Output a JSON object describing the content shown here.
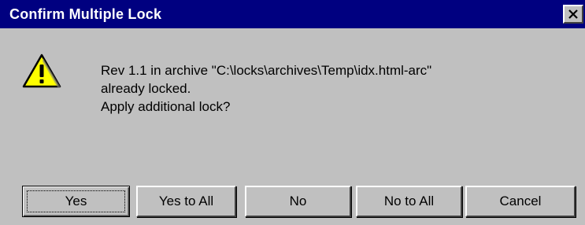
{
  "window": {
    "title": "Confirm Multiple Lock",
    "close_glyph": "✕"
  },
  "icon": {
    "name": "warning-icon",
    "color": "#ffff00"
  },
  "message": {
    "line1": "Rev 1.1 in archive \"C:\\locks\\archives\\Temp\\idx.html-arc\"",
    "line2": "already locked.",
    "line3": "Apply additional lock?"
  },
  "buttons": {
    "yes": "Yes",
    "yes_to_all": "Yes to All",
    "no": "No",
    "no_to_all": "No to All",
    "cancel": "Cancel"
  },
  "colors": {
    "titlebar": "#000080",
    "dialog": "#c0c0c0"
  }
}
